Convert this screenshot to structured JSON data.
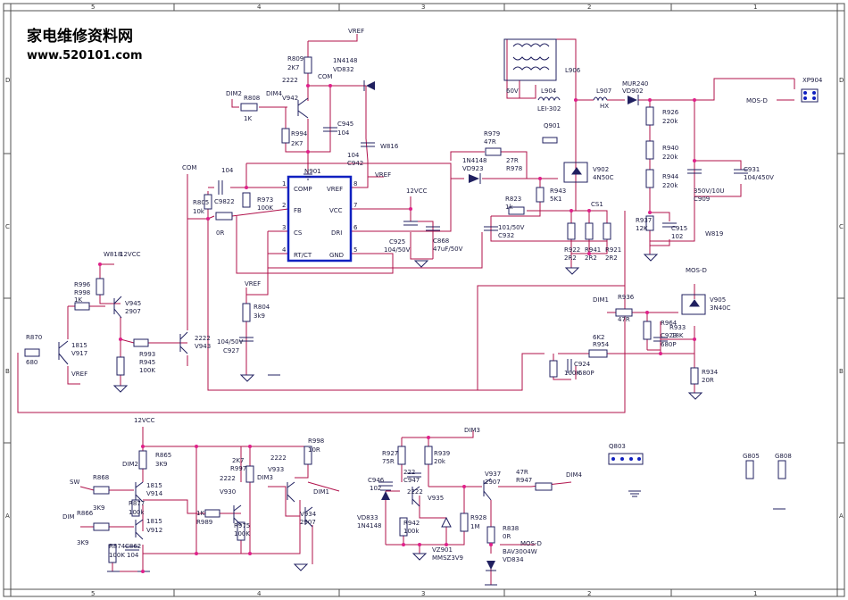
{
  "header": {
    "title": "家电维修资料网",
    "url": "www.520101.com"
  },
  "border": {
    "columns": [
      "5",
      "4",
      "3",
      "2",
      "1"
    ],
    "rows": [
      "D",
      "C",
      "B",
      "A"
    ]
  },
  "ic": {
    "name": "N901",
    "pins_left": [
      {
        "num": "1",
        "label": "COMP"
      },
      {
        "num": "2",
        "label": "FB"
      },
      {
        "num": "3",
        "label": "CS"
      },
      {
        "num": "4",
        "label": "RT/CT"
      }
    ],
    "pins_right": [
      {
        "num": "8",
        "label": "VREF"
      },
      {
        "num": "7",
        "label": "VCC"
      },
      {
        "num": "6",
        "label": "DRI"
      },
      {
        "num": "5",
        "label": "GND"
      }
    ]
  },
  "labels": {
    "vref_top": "VREF",
    "r809": "R809",
    "r809_v": "2K7",
    "d_1n4148": "1N4148",
    "vd832": "VD832",
    "v2222": "2222",
    "com": "COM",
    "dim2": "DIM2",
    "dim4": "DIM4",
    "v942": "V942",
    "r808": "R808",
    "r808_v": "1K",
    "r994": "R994",
    "r994_v": "2K7",
    "c945": "C945",
    "c945_v": "104",
    "w816": "W816",
    "c942_v": "104",
    "c942": "C942",
    "vref_ic": "VREF",
    "c_104": "104",
    "r805": "R805",
    "r805_v": "10k",
    "c_ovl": "C9822",
    "r973": "R973",
    "r973_v": "100K",
    "r_0r": "0R",
    "com2": "COM",
    "r979": "R979",
    "r979_v": "47R",
    "d2_1n4148": "1N4148",
    "vd923": "VD923",
    "r978_v": "27R",
    "r978": "R978",
    "r943": "R943",
    "r943_v": "5K1",
    "r823": "R823",
    "r823_v": "1k",
    "v12vcc": "12VCC",
    "c932_v": "101/50V",
    "c932": "C932",
    "c925": "C925",
    "c925_v": "104/50V",
    "c868": "C868",
    "c868_v": "47uF/50V",
    "cs1": "CS1",
    "r922": "R922",
    "r922_v": "2R2",
    "r941": "R941",
    "r941_v": "2R2",
    "r921": "R921",
    "r921_v": "2R2",
    "v902": "V902",
    "v902_v": "4N50C",
    "q901": "Q901",
    "l906": "L906",
    "l904": "L904",
    "lei302": "LEI-302",
    "v60": "60V",
    "l907": "L907",
    "hx": "HX",
    "mur240": "MUR240",
    "vd902": "VD902",
    "r926": "R926",
    "r926_v": "220k",
    "r940": "R940",
    "r940_v": "220k",
    "r944": "R944",
    "r944_v": "220k",
    "r937": "R937",
    "r937_v": "12K",
    "c915": "C915",
    "c915_v": "102",
    "c909_v": "350V/10U",
    "c909": "C909",
    "c931": "C931",
    "c931_v": "104/450V",
    "w819": "W819",
    "xp904": "XP904",
    "mosd": "MOS-D",
    "mosd2": "MOS-D",
    "dim1": "DIM1",
    "r936": "R936",
    "r936_v": "47R",
    "v905": "V905",
    "v905_v": "3N40C",
    "r964": "R964",
    "r933": "R933",
    "r_18k": "18K",
    "c_b3": "C923",
    "c_680p": "680P",
    "r_6k2": "6K2",
    "r954": "R954",
    "c924": "C924",
    "c924_v": "680P",
    "r_100k2": "100K",
    "r934": "R934",
    "r934_v": "20R",
    "w818": "W818",
    "v12vcc2": "12VCC",
    "r996": "R996",
    "r998a": "R998",
    "r_1k": "1K",
    "v945": "V945",
    "v945_v": "2907",
    "r870": "R870",
    "r870_v": "680",
    "v917": "V917",
    "v1815": "1815",
    "vref3": "VREF",
    "r993": "R993",
    "r945": "R945",
    "r945_v": "100K",
    "v943": "V943",
    "v943_v": "2222",
    "vref4": "VREF",
    "r804": "R804",
    "r804_v": "3k9",
    "c927_v": "104/50V",
    "c927": "C927",
    "v12vcc3": "12VCC",
    "r865": "R865",
    "r865_v": "3K9",
    "dim2b": "DIM2",
    "sw": "SW",
    "r868": "R868",
    "r868_v": "3K9",
    "v914": "V914",
    "v914_t": "1815",
    "r877": "R877",
    "r877_v": "100k",
    "dimb": "DIM",
    "r866": "R866",
    "r866_v": "3K9",
    "v912": "V912",
    "v912_t": "1815",
    "r874": "R874",
    "c862": "C862",
    "r874_v": "100K",
    "c862_v": "104",
    "r989_v": "1K",
    "r989": "R989",
    "r997_v": "2K7",
    "r997": "R997",
    "v930_t": "2222",
    "v930": "V930",
    "r975": "R975",
    "r975_v": "100K",
    "dim3": "DIM3",
    "v933": "V933",
    "v933_t": "2222",
    "r998": "R998",
    "r998_v": "10R",
    "dim1b": "DIM1",
    "v934": "V934",
    "v934_v": "2907",
    "dim3b": "DIM3",
    "r927": "R927",
    "r927_v": "75R",
    "r939": "R939",
    "r939_v": "20k",
    "c946": "C946",
    "c946_v": "102",
    "c947_v": "222",
    "c947": "C947",
    "v935_t": "2222",
    "v935": "V935",
    "vd833": "VD833",
    "vd833_v": "1N4148",
    "r942": "R942",
    "r942_v": "100k",
    "vz901": "VZ901",
    "vz901_v": "MMSZ3V9",
    "r928": "R928",
    "r928_v": "1M",
    "v937": "V937",
    "v937_v": "2907",
    "r947_v": "47R",
    "r947": "R947",
    "dim4b": "DIM4",
    "r838": "R838",
    "r_0r2": "0R",
    "mosd3": "MOS-D",
    "bav": "BAV3004W",
    "vd834": "VD834",
    "q803": "Q803",
    "g805": "G805",
    "g808": "G808"
  }
}
